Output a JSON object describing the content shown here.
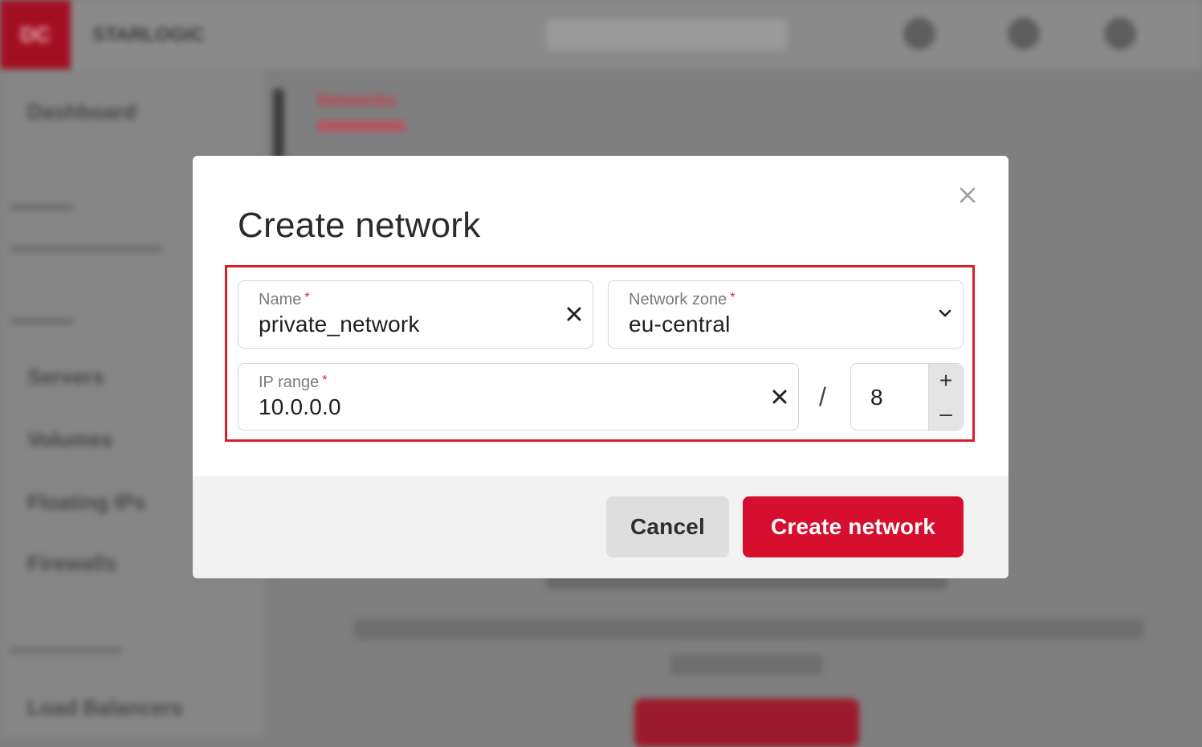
{
  "background": {
    "logo_text": "DC",
    "project_name": "STARLOGIC",
    "sidebar": {
      "dashboard": "Dashboard",
      "servers": "Servers",
      "volumes": "Volumes",
      "floating_ips": "Floating IPs",
      "firewalls": "Firewalls",
      "load_balancers": "Load Balancers"
    },
    "breadcrumb": "Networks"
  },
  "modal": {
    "title": "Create network",
    "close_icon": "close-icon",
    "name_field": {
      "label": "Name",
      "required_mark": "*",
      "value": "private_network"
    },
    "zone_field": {
      "label": "Network zone",
      "required_mark": "*",
      "value": "eu-central"
    },
    "ip_range_field": {
      "label": "IP range",
      "required_mark": "*",
      "value": "10.0.0.0"
    },
    "separator": "/",
    "prefix_stepper": {
      "value": "8",
      "increment": "+",
      "decrement": "–"
    },
    "buttons": {
      "cancel": "Cancel",
      "create": "Create network"
    },
    "colors": {
      "accent": "#d70f2f",
      "highlight_border": "#d81e2a"
    }
  }
}
